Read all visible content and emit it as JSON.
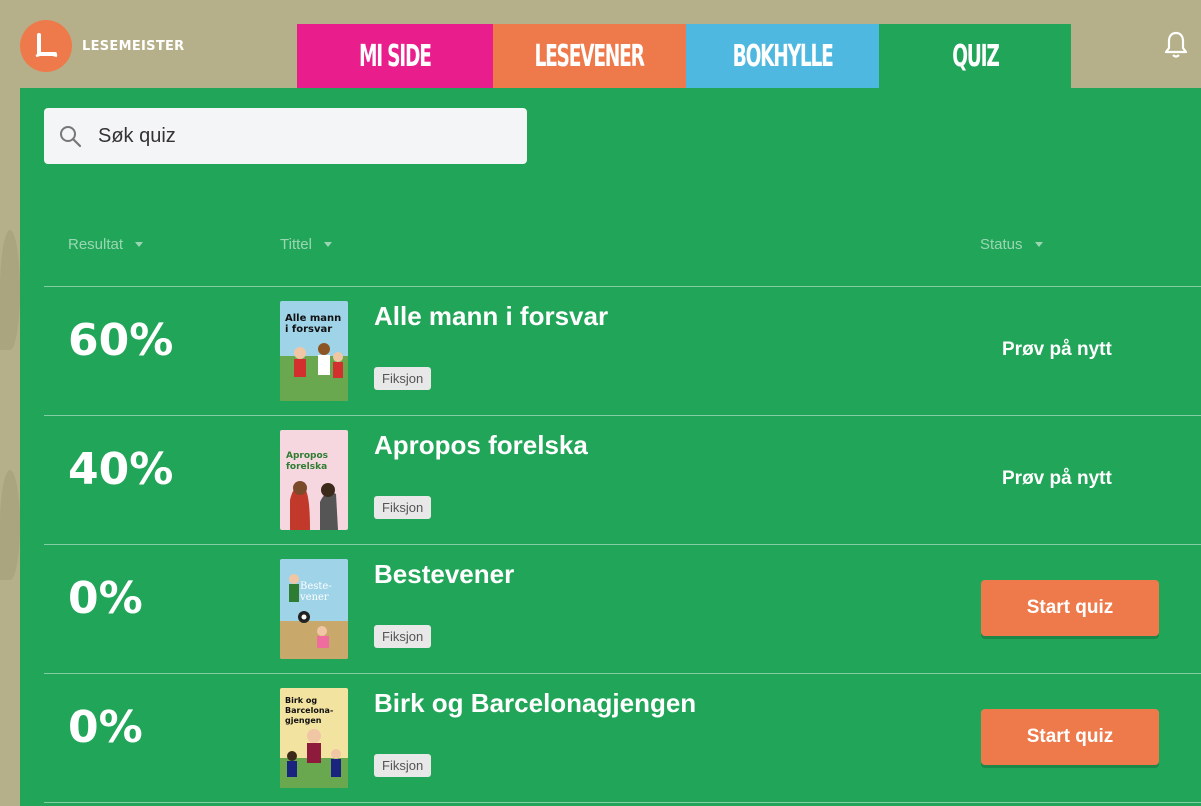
{
  "app": {
    "logo_text": "LESEMEISTER"
  },
  "tabs": [
    {
      "label": "MI SIDE",
      "color": "#e91e8c"
    },
    {
      "label": "LESEVENER",
      "color": "#ee7a4b"
    },
    {
      "label": "BOKHYLLE",
      "color": "#4fb8e0"
    },
    {
      "label": "QUIZ",
      "color": "#21a558",
      "active": true
    }
  ],
  "search": {
    "placeholder": "Søk quiz",
    "value": ""
  },
  "columns": {
    "result": "Resultat",
    "title": "Tittel",
    "status": "Status"
  },
  "quizzes": [
    {
      "result": "60%",
      "title": "Alle mann i forsvar",
      "tag": "Fiksjon",
      "status": "Prøv på nytt",
      "action": "retry"
    },
    {
      "result": "40%",
      "title": "Apropos forelska",
      "tag": "Fiksjon",
      "status": "Prøv på nytt",
      "action": "retry"
    },
    {
      "result": "0%",
      "title": "Bestevener",
      "tag": "Fiksjon",
      "status": "Start quiz",
      "action": "start"
    },
    {
      "result": "0%",
      "title": "Birk og Barcelonagjengen",
      "tag": "Fiksjon",
      "status": "Start quiz",
      "action": "start"
    }
  ],
  "covers": [
    {
      "text": "Alle mann i forsvar",
      "bg": "#9fd3e8",
      "ground": "#6aa84f"
    },
    {
      "text": "Apropos forelska",
      "bg": "#f6d6df",
      "ground": "#f6d6df"
    },
    {
      "text": "Beste-vener",
      "bg": "#9fd3e8",
      "ground": "#c9a86b"
    },
    {
      "text": "Birk og Barcelona-gjengen",
      "bg": "#f3e3a0",
      "ground": "#6aa84f"
    }
  ],
  "colors": {
    "accent": "#ee7a4b",
    "panel": "#21a558"
  }
}
